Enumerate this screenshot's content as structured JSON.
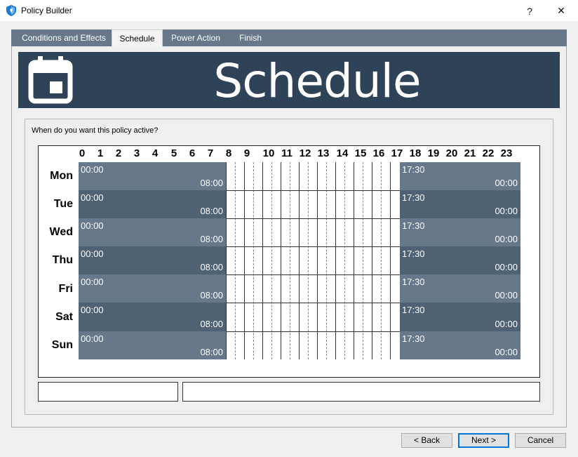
{
  "window": {
    "title": "Policy Builder",
    "help_glyph": "?",
    "close_glyph": "✕"
  },
  "tabs": [
    {
      "label": "Conditions and Effects",
      "active": false
    },
    {
      "label": "Schedule",
      "active": true
    },
    {
      "label": "Power Action",
      "active": false
    },
    {
      "label": "Finish",
      "active": false
    }
  ],
  "banner": {
    "title": "Schedule",
    "icon": "calendar-icon"
  },
  "schedule": {
    "prompt": "When do you want this policy active?",
    "hours": [
      "0",
      "1",
      "2",
      "3",
      "4",
      "5",
      "6",
      "7",
      "8",
      "9",
      "10",
      "11",
      "12",
      "13",
      "14",
      "15",
      "16",
      "17",
      "18",
      "19",
      "20",
      "21",
      "22",
      "23"
    ],
    "days": [
      {
        "name": "Mon",
        "blocks": [
          {
            "start": "00:00",
            "end": "08:00"
          },
          {
            "start": "17:30",
            "end": "00:00"
          }
        ]
      },
      {
        "name": "Tue",
        "blocks": [
          {
            "start": "00:00",
            "end": "08:00"
          },
          {
            "start": "17:30",
            "end": "00:00"
          }
        ]
      },
      {
        "name": "Wed",
        "blocks": [
          {
            "start": "00:00",
            "end": "08:00"
          },
          {
            "start": "17:30",
            "end": "00:00"
          }
        ]
      },
      {
        "name": "Thu",
        "blocks": [
          {
            "start": "00:00",
            "end": "08:00"
          },
          {
            "start": "17:30",
            "end": "00:00"
          }
        ]
      },
      {
        "name": "Fri",
        "blocks": [
          {
            "start": "00:00",
            "end": "08:00"
          },
          {
            "start": "17:30",
            "end": "00:00"
          }
        ]
      },
      {
        "name": "Sat",
        "blocks": [
          {
            "start": "00:00",
            "end": "08:00"
          },
          {
            "start": "17:30",
            "end": "00:00"
          }
        ]
      },
      {
        "name": "Sun",
        "blocks": [
          {
            "start": "00:00",
            "end": "08:00"
          },
          {
            "start": "17:30",
            "end": "00:00"
          }
        ]
      }
    ],
    "colors": {
      "block_light": "#66788a",
      "block_dark": "#4f6273"
    },
    "field_left_value": "",
    "field_right_value": ""
  },
  "footer": {
    "back_label": "< Back",
    "next_label": "Next >",
    "cancel_label": "Cancel"
  }
}
